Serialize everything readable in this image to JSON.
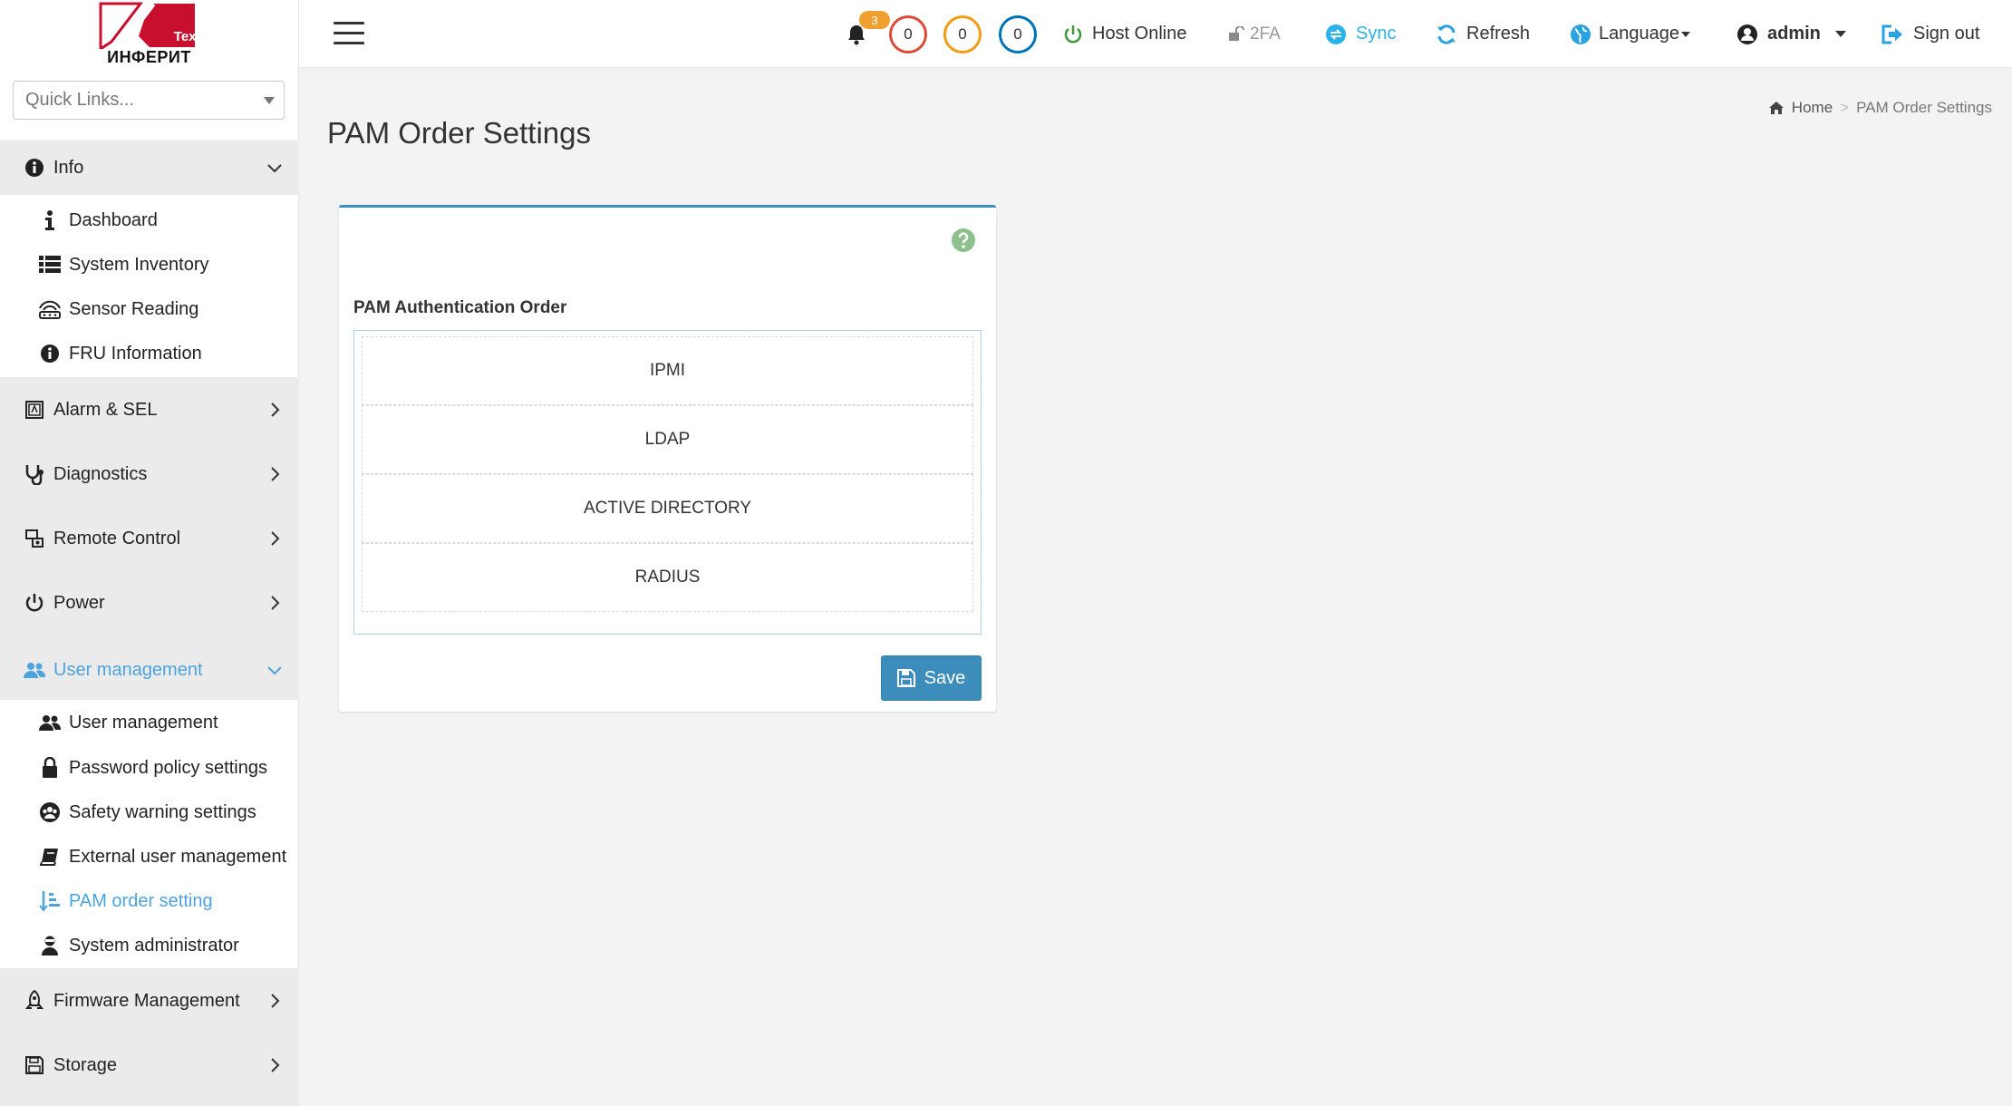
{
  "brand": {
    "name": "ИНФЕРИТ",
    "tag": "Tex",
    "logo_red": "#c8102e"
  },
  "quick_links": {
    "placeholder": "Quick Links..."
  },
  "sidebar": {
    "sections": [
      {
        "label": "Info",
        "icon": "info-circle-icon",
        "expanded": true
      },
      {
        "label": "Alarm & SEL",
        "icon": "alarm-icon"
      },
      {
        "label": "Diagnostics",
        "icon": "stethoscope-icon"
      },
      {
        "label": "Remote Control",
        "icon": "remote-control-icon"
      },
      {
        "label": "Power",
        "icon": "power-icon"
      },
      {
        "label": "User management",
        "icon": "users-icon",
        "expanded": true,
        "active": true
      },
      {
        "label": "Firmware Management",
        "icon": "rocket-icon"
      },
      {
        "label": "Storage",
        "icon": "floppy-icon"
      }
    ],
    "info_items": [
      {
        "label": "Dashboard",
        "icon": "info-icon"
      },
      {
        "label": "System Inventory",
        "icon": "list-icon"
      },
      {
        "label": "Sensor Reading",
        "icon": "sensor-icon"
      },
      {
        "label": "FRU Information",
        "icon": "info-circle-icon"
      }
    ],
    "user_items": [
      {
        "label": "User management",
        "icon": "users-icon"
      },
      {
        "label": "Password policy settings",
        "icon": "lock-icon"
      },
      {
        "label": "Safety warning settings",
        "icon": "group-icon"
      },
      {
        "label": "External user management",
        "icon": "book-icon"
      },
      {
        "label": "PAM order setting",
        "icon": "sort-icon",
        "active": true
      },
      {
        "label": "System administrator",
        "icon": "admin-icon"
      }
    ]
  },
  "header": {
    "notifications": "3",
    "counts": [
      {
        "value": "0",
        "color": "#dd4b39"
      },
      {
        "value": "0",
        "color": "#f39c12"
      },
      {
        "value": "0",
        "color": "#0073b7"
      }
    ],
    "host_status": "Host Online",
    "twofa": "2FA",
    "sync": "Sync",
    "refresh": "Refresh",
    "language": "Language",
    "user": "admin",
    "signout": "Sign out"
  },
  "breadcrumb": {
    "home": "Home",
    "sep": ">",
    "current": "PAM Order Settings"
  },
  "page": {
    "title": "PAM Order Settings",
    "section_label": "PAM Authentication Order",
    "order": [
      "IPMI",
      "LDAP",
      "ACTIVE DIRECTORY",
      "RADIUS"
    ],
    "save": "Save"
  },
  "colors": {
    "accent": "#3c8dbc",
    "active_link": "#4da3dc",
    "green": "#3c9a3c"
  }
}
